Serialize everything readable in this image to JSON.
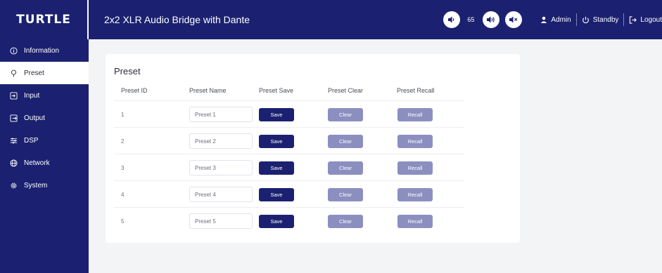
{
  "brand": "TURTLE",
  "app_title": "2x2 XLR Audio Bridge with Dante",
  "volume": {
    "value": "65"
  },
  "user": {
    "name": "Admin",
    "standby": "Standby",
    "logout": "Logout"
  },
  "sidebar": {
    "items": [
      {
        "label": "Information",
        "icon": "info-icon"
      },
      {
        "label": "Preset",
        "icon": "pin-icon"
      },
      {
        "label": "Input",
        "icon": "input-icon"
      },
      {
        "label": "Output",
        "icon": "output-icon"
      },
      {
        "label": "DSP",
        "icon": "sliders-icon"
      },
      {
        "label": "Network",
        "icon": "globe-icon"
      },
      {
        "label": "System",
        "icon": "gear-icon"
      }
    ]
  },
  "preset": {
    "title": "Preset",
    "columns": [
      "Preset ID",
      "Preset Name",
      "Preset Save",
      "Preset Clear",
      "Preset Recall"
    ],
    "rows": [
      {
        "id": "1",
        "name": "Preset 1",
        "save": "Save",
        "clear": "Clear",
        "recall": "Recall"
      },
      {
        "id": "2",
        "name": "Preset 2",
        "save": "Save",
        "clear": "Clear",
        "recall": "Recall"
      },
      {
        "id": "3",
        "name": "Preset 3",
        "save": "Save",
        "clear": "Clear",
        "recall": "Recall"
      },
      {
        "id": "4",
        "name": "Preset 4",
        "save": "Save",
        "clear": "Clear",
        "recall": "Recall"
      },
      {
        "id": "5",
        "name": "Preset 5",
        "save": "Save",
        "clear": "Clear",
        "recall": "Recall"
      }
    ]
  },
  "colors": {
    "primary": "#1b2170",
    "muted_button": "#8b8fc0",
    "background": "#f3f4f6"
  }
}
